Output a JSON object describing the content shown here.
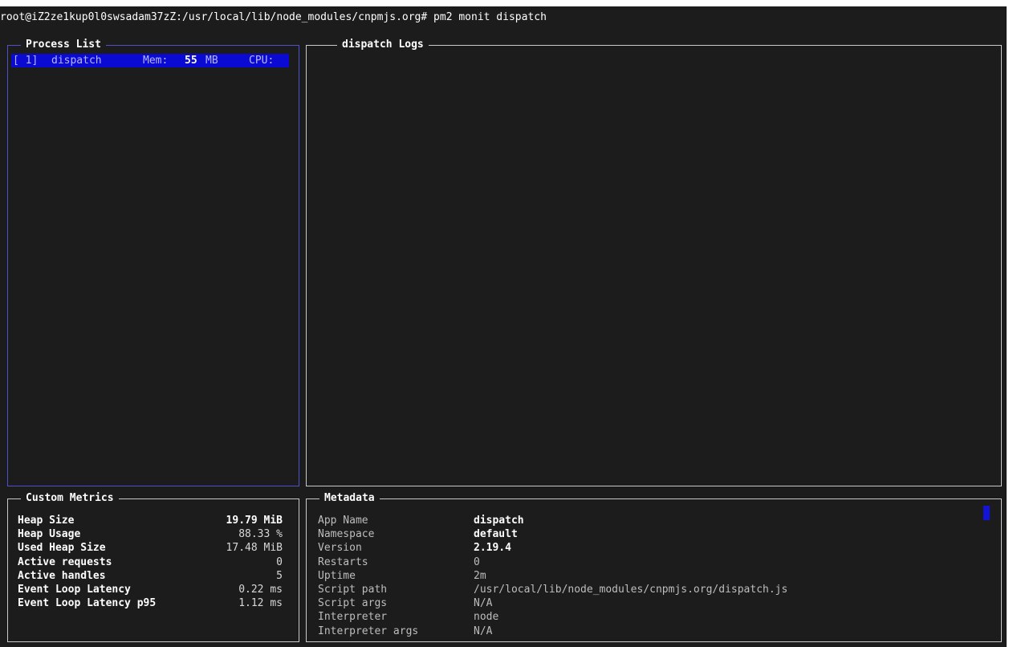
{
  "prompt": "root@iZ2ze1kup0l0swsadam37zZ:/usr/local/lib/node_modules/cnpmjs.org# pm2 monit dispatch",
  "process_list": {
    "title": "Process List",
    "rows": [
      {
        "id": "[ 1]",
        "name": "dispatch",
        "mem_label": "Mem:",
        "mem_value": "55",
        "mem_unit": "MB",
        "cpu_label": "CPU:"
      }
    ]
  },
  "logs": {
    "title": "dispatch Logs"
  },
  "custom_metrics": {
    "title": "Custom Metrics",
    "items": [
      {
        "label": "Heap Size",
        "value": "19.79 MiB"
      },
      {
        "label": "Heap Usage",
        "value": "88.33 %"
      },
      {
        "label": "Used Heap Size",
        "value": "17.48 MiB"
      },
      {
        "label": "Active requests",
        "value": "0"
      },
      {
        "label": "Active handles",
        "value": "5"
      },
      {
        "label": "Event Loop Latency",
        "value": "0.22 ms"
      },
      {
        "label": "Event Loop Latency p95",
        "value": "1.12 ms"
      }
    ]
  },
  "metadata": {
    "title": "Metadata",
    "items": [
      {
        "label": "App Name",
        "value": "dispatch"
      },
      {
        "label": "Namespace",
        "value": "default"
      },
      {
        "label": "Version",
        "value": "2.19.4"
      },
      {
        "label": "Restarts",
        "value": "0"
      },
      {
        "label": "Uptime",
        "value": "2m"
      },
      {
        "label": "Script path",
        "value": "/usr/local/lib/node_modules/cnpmjs.org/dispatch.js"
      },
      {
        "label": "Script args",
        "value": "N/A"
      },
      {
        "label": "Interpreter",
        "value": "node"
      },
      {
        "label": "Interpreter args",
        "value": "N/A"
      }
    ]
  },
  "colors": {
    "background": "#1c1c1c",
    "border": "#c9c9c9",
    "focused_border": "#5050c8",
    "selection": "#0a0ad2"
  }
}
